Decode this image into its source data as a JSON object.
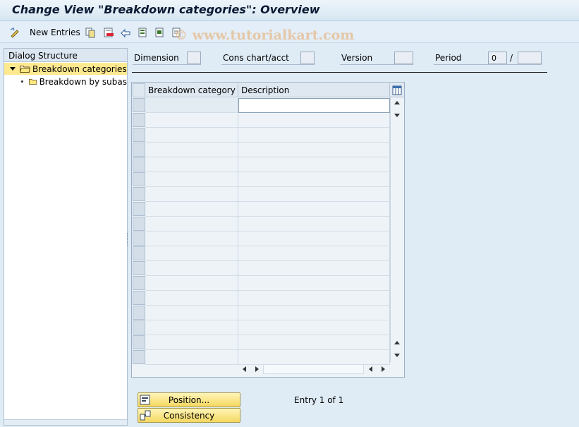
{
  "window": {
    "title": "Change View \"Breakdown categories\": Overview"
  },
  "toolbar": {
    "new_entries_label": "New Entries",
    "icons": [
      "display-change-icon",
      "copy-icon",
      "delete-icon",
      "undo-icon",
      "select-all-icon",
      "select-block-icon",
      "deselect-all-icon"
    ]
  },
  "watermark": "© www.tutorialkart.com",
  "dialog": {
    "header": "Dialog Structure",
    "items": [
      {
        "label": "Breakdown categories",
        "selected": true
      },
      {
        "label": "Breakdown by subas",
        "selected": false
      }
    ]
  },
  "fields": {
    "dimension": {
      "label": "Dimension",
      "value": ""
    },
    "cons_chart": {
      "label": "Cons chart/acct",
      "value": ""
    },
    "version": {
      "label": "Version",
      "value": ""
    },
    "period": {
      "label": "Period",
      "value": "0",
      "separator": "/",
      "year": ""
    }
  },
  "table": {
    "columns": [
      "Breakdown category",
      "Description"
    ],
    "rows": 18
  },
  "buttons": {
    "position": "Position...",
    "consistency": "Consistency"
  },
  "entry_info": "Entry 1 of 1",
  "colors": {
    "selected": "#ffe98f",
    "button": "#f5d860",
    "background": "#dfebf5"
  }
}
